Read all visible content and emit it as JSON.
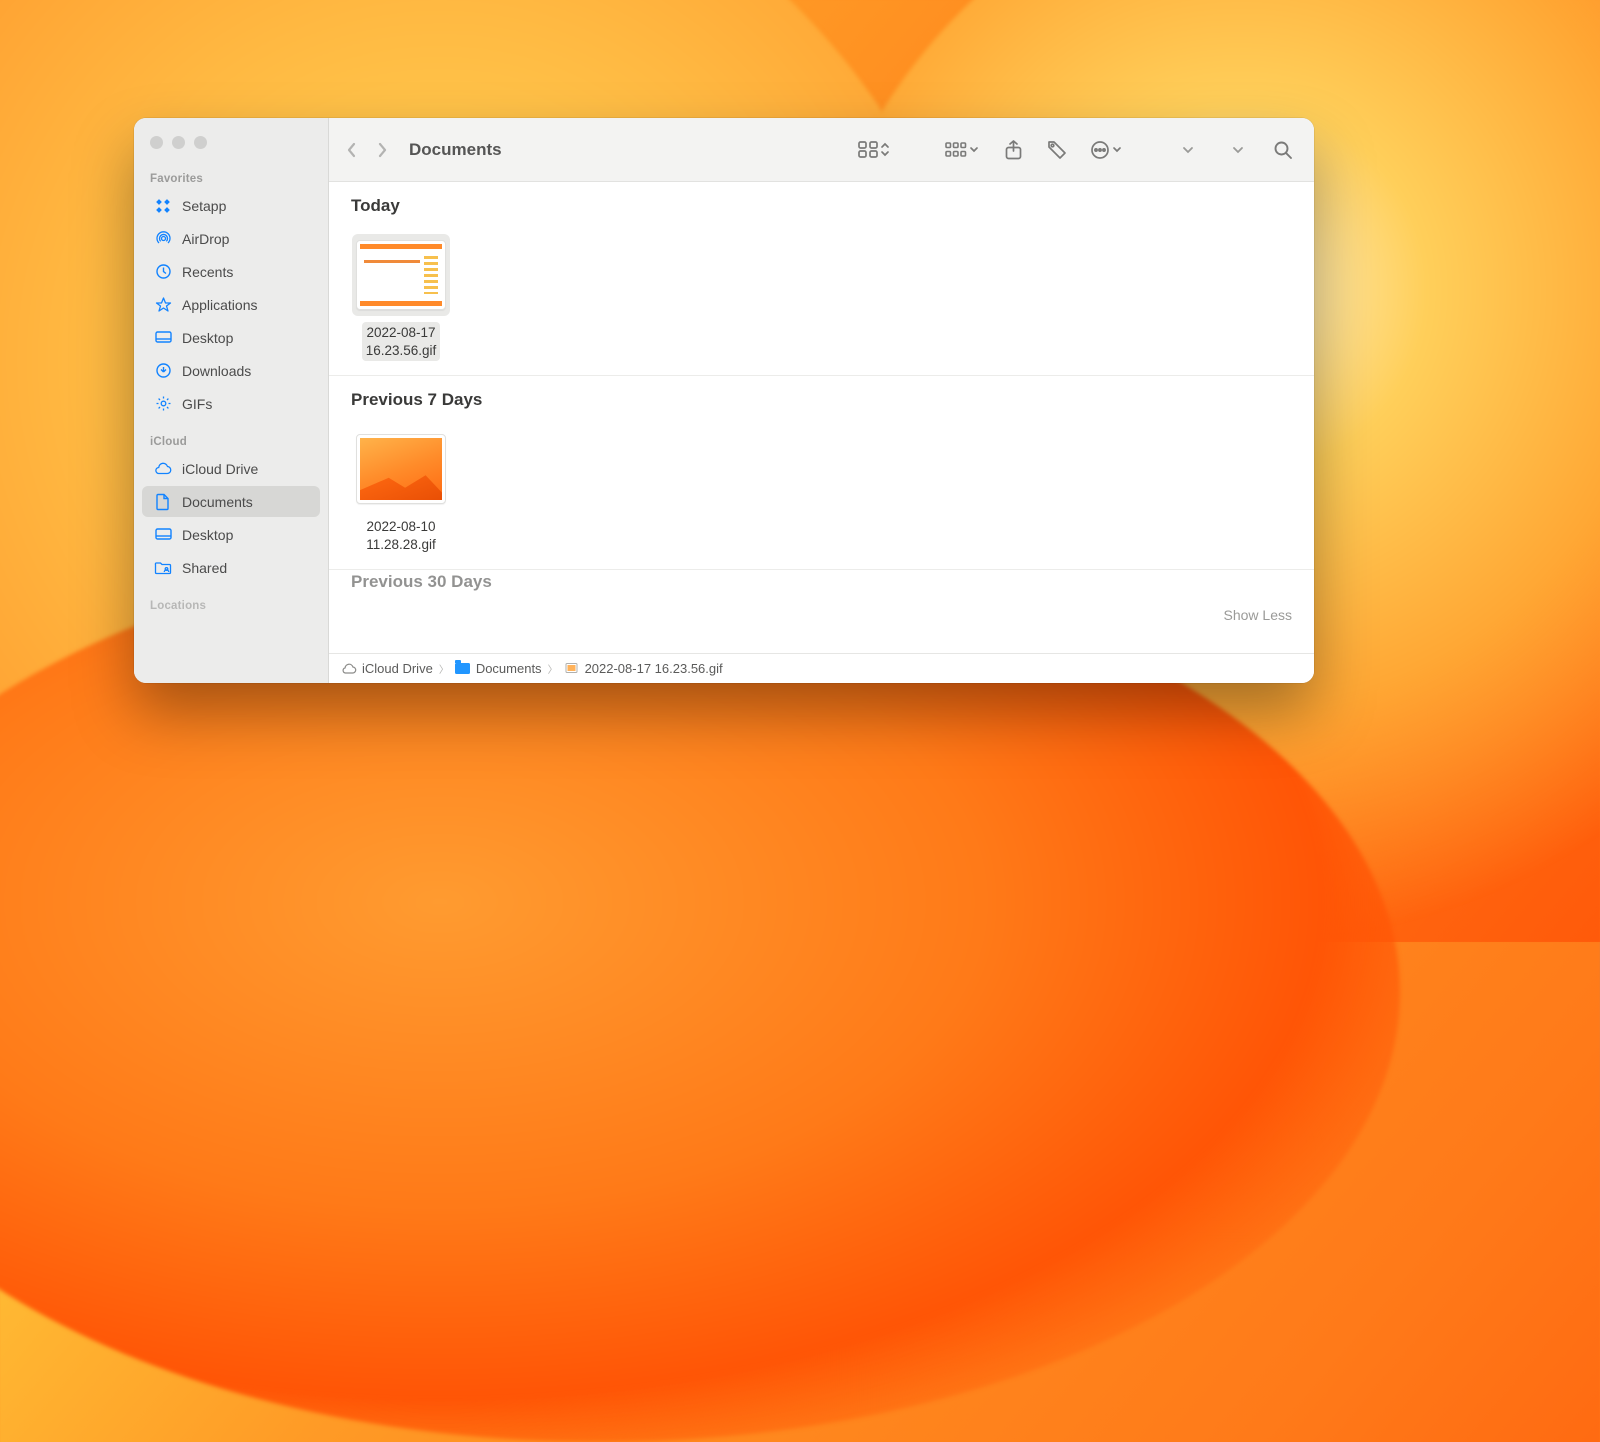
{
  "window": {
    "title": "Documents"
  },
  "sidebar": {
    "sections": [
      {
        "label": "Favorites",
        "items": [
          {
            "label": "Setapp",
            "icon": "setapp-icon",
            "selected": false
          },
          {
            "label": "AirDrop",
            "icon": "airdrop-icon",
            "selected": false
          },
          {
            "label": "Recents",
            "icon": "recents-icon",
            "selected": false
          },
          {
            "label": "Applications",
            "icon": "applications-icon",
            "selected": false
          },
          {
            "label": "Desktop",
            "icon": "desktop-icon",
            "selected": false
          },
          {
            "label": "Downloads",
            "icon": "downloads-icon",
            "selected": false
          },
          {
            "label": "GIFs",
            "icon": "gear-icon",
            "selected": false
          }
        ]
      },
      {
        "label": "iCloud",
        "items": [
          {
            "label": "iCloud Drive",
            "icon": "cloud-icon",
            "selected": false
          },
          {
            "label": "Documents",
            "icon": "doc-icon",
            "selected": true
          },
          {
            "label": "Desktop",
            "icon": "desktop-icon",
            "selected": false
          },
          {
            "label": "Shared",
            "icon": "shared-folder-icon",
            "selected": false
          }
        ]
      },
      {
        "label": "Locations",
        "items": []
      }
    ]
  },
  "toolbar": {
    "back_enabled": false,
    "forward_enabled": false
  },
  "content": {
    "groups": [
      {
        "heading": "Today",
        "files": [
          {
            "name": "2022-08-17 16.23.56.gif",
            "name_wrapped": "2022-08-17\n16.23.56.gif",
            "selected": true,
            "thumb": "a"
          }
        ]
      },
      {
        "heading": "Previous 7 Days",
        "files": [
          {
            "name": "2022-08-10 11.28.28.gif",
            "name_wrapped": "2022-08-10\n11.28.28.gif",
            "selected": false,
            "thumb": "b"
          }
        ]
      },
      {
        "heading": "Previous 30 Days",
        "files": []
      }
    ],
    "show_less_label": "Show Less"
  },
  "pathbar": {
    "segments": [
      {
        "label": "iCloud Drive",
        "icon": "cloud"
      },
      {
        "label": "Documents",
        "icon": "folder"
      },
      {
        "label": "2022-08-17 16.23.56.gif",
        "icon": "file"
      }
    ]
  }
}
